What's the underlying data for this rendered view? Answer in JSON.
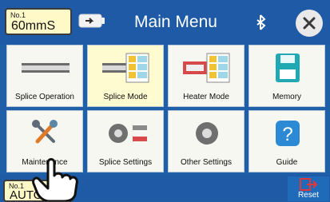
{
  "header": {
    "status_small": "No.1",
    "status_value": "60mmS",
    "title": "Main Menu"
  },
  "tiles": [
    {
      "label": "Splice Operation"
    },
    {
      "label": "Splice Mode"
    },
    {
      "label": "Heater Mode"
    },
    {
      "label": "Memory"
    },
    {
      "label": "Maintenance"
    },
    {
      "label": "Splice Settings"
    },
    {
      "label": "Other Settings"
    },
    {
      "label": "Guide"
    }
  ],
  "footer": {
    "status_small": "No.1",
    "status_value": "AUTO",
    "reset_label": "Reset"
  },
  "colors": {
    "background": "#1e5aa6",
    "tile": "#f7f7f2",
    "active_tile": "#fffbd1",
    "accent_red": "#e0383a"
  },
  "icons": [
    "battery-icon",
    "bluetooth-icon",
    "close-icon",
    "splice-operation-icon",
    "splice-mode-icon",
    "heater-mode-icon",
    "memory-icon",
    "maintenance-icon",
    "splice-settings-icon",
    "other-settings-icon",
    "guide-icon",
    "reset-icon",
    "pointing-hand-icon"
  ]
}
